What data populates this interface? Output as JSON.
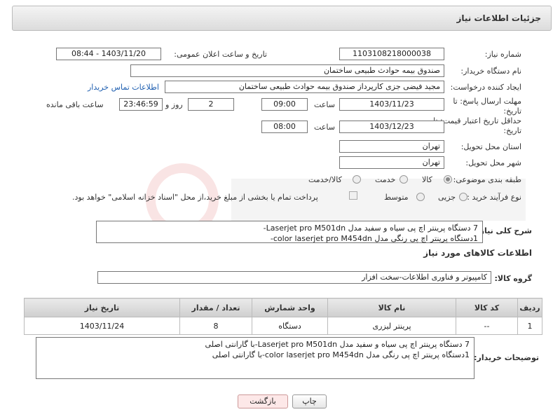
{
  "header": {
    "title": "جزئیات اطلاعات نیاز"
  },
  "form": {
    "need_number_label": "شماره نیاز:",
    "need_number": "1103108218000038",
    "announce_label": "تاریخ و ساعت اعلان عمومی:",
    "announce_value": "1403/11/20 - 08:44",
    "buyer_org_label": "نام دستگاه خریدار:",
    "buyer_org": "صندوق بیمه حوادث طبیعی ساختمان",
    "requester_label": "ایجاد کننده درخواست:",
    "requester": "مجید فیضی جزی کارپرداز صندوق بیمه حوادث طبیعی ساختمان",
    "contact_link": "اطلاعات تماس خریدار",
    "deadline_label": "مهلت ارسال پاسخ: تا تاریخ:",
    "deadline_date": "1403/11/23",
    "time_label": "ساعت",
    "deadline_time": "09:00",
    "days_value": "2",
    "days_label": "روز و",
    "remaining_time": "23:46:59",
    "remaining_label": "ساعت باقی مانده",
    "validity_label": "حداقل تاریخ اعتبار قیمت: تا تاریخ:",
    "validity_date": "1403/12/23",
    "validity_time": "08:00",
    "province_label": "استان محل تحویل:",
    "province": "تهران",
    "city_label": "شهر محل تحویل:",
    "city": "تهران",
    "category_label": "طبقه بندی موضوعی:",
    "category_options": [
      "کالا",
      "خدمت",
      "کالا/خدمت"
    ],
    "process_label": "نوع فرآیند خرید :",
    "process_options": [
      "جزیی",
      "متوسط"
    ],
    "payment_note": "پرداخت تمام یا بخشی از مبلغ خرید،از محل \"اسناد خزانه اسلامی\" خواهد بود."
  },
  "description": {
    "label": "شرح کلی نیاز:",
    "lines": [
      "7 دستگاه پرینتر اچ پی سیاه و سفید مدل Laserjet pro M501dn-",
      "1دستگاه پرینتر اچ پی رنگی مدل color laserjet pro M454dn-"
    ]
  },
  "goods": {
    "section_title": "اطلاعات کالاهای مورد نیاز",
    "group_label": "گروه کالا:",
    "group_value": "کامپیوتر و فناوری اطلاعات-سخت افزار",
    "columns": [
      "ردیف",
      "کد کالا",
      "نام کالا",
      "واحد شمارش",
      "تعداد / مقدار",
      "تاریخ نیاز"
    ],
    "rows": [
      [
        "1",
        "--",
        "پرینتر لیزری",
        "دستگاه",
        "8",
        "1403/11/24"
      ]
    ]
  },
  "buyer_notes": {
    "label": "توضیحات خریدار:",
    "lines": [
      "7 دستگاه پرینتر اچ پی سیاه و سفید مدل Laserjet pro M501dn-با گارانتی اصلی",
      "1دستگاه پرینتر اچ پی رنگی مدل color laserjet pro M454dn-با گارانتی اصلی"
    ]
  },
  "buttons": {
    "print": "چاپ",
    "back": "بازگشت"
  },
  "colors": {
    "link": "#1f5fb0",
    "back_button_bg": "#fde8e8"
  }
}
